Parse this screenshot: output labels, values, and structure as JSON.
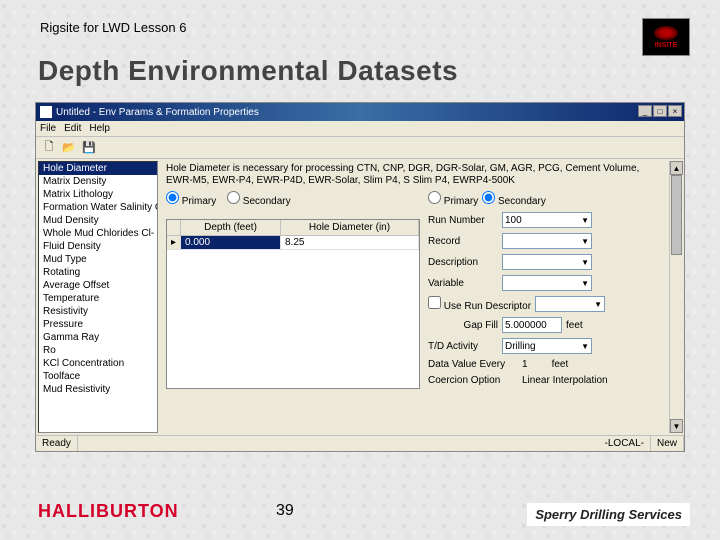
{
  "header": {
    "lesson": "Rigsite for LWD Lesson 6",
    "insite": "INSITE"
  },
  "title": "Depth Environmental Datasets",
  "page_number": "39",
  "footer": {
    "halliburton": "HALLIBURTON",
    "sperry": "Sperry Drilling Services"
  },
  "window": {
    "title": "Untitled - Env Params & Formation Properties",
    "menu": {
      "file": "File",
      "edit": "Edit",
      "help": "Help"
    },
    "sidebar_items": [
      "Hole Diameter",
      "Matrix Density",
      "Matrix Lithology",
      "Formation Water Salinity Cl-",
      "Mud Density",
      "Whole Mud Chlorides Cl-",
      "Fluid Density",
      "Mud Type",
      "Rotating",
      "Average Offset",
      "Temperature",
      "Resistivity",
      "Pressure",
      "Gamma Ray",
      "Ro",
      "KCl Concentration",
      "Toolface",
      "Mud Resistivity"
    ],
    "sidebar_selected": "Hole Diameter",
    "description": "Hole Diameter is necessary for processing CTN, CNP, DGR, DGR-Solar, GM, AGR, PCG, Cement Volume, EWR-M5, EWR-P4, EWR-P4D, EWR-Solar, Slim P4, S Slim P4, EWRP4-500K",
    "left_radio": {
      "primary": "Primary",
      "secondary": "Secondary",
      "selected": "Primary"
    },
    "right_radio": {
      "primary": "Primary",
      "secondary": "Secondary",
      "selected": "Secondary"
    },
    "grid": {
      "col1": "Depth (feet)",
      "col2": "Hole Diameter (in)",
      "rows": [
        {
          "depth": "0.000",
          "value": "8.25"
        }
      ]
    },
    "fields": {
      "run_number": {
        "label": "Run Number",
        "value": "100"
      },
      "record": {
        "label": "Record",
        "value": ""
      },
      "description_f": {
        "label": "Description",
        "value": ""
      },
      "variable": {
        "label": "Variable",
        "value": ""
      },
      "use_run_descriptor": {
        "label": "Use Run Descriptor",
        "checked": false
      },
      "gap_fill": {
        "label": "Gap Fill",
        "value": "5.000000",
        "unit": "feet"
      },
      "td_activity": {
        "label": "T/D Activity",
        "value": "Drilling"
      },
      "data_value_every": {
        "label": "Data Value Every",
        "value": "1",
        "unit": "feet"
      },
      "coercion": {
        "label": "Coercion Option",
        "value": "Linear Interpolation"
      }
    },
    "status": {
      "ready": "Ready",
      "local": "-LOCAL-",
      "new": "New"
    }
  }
}
